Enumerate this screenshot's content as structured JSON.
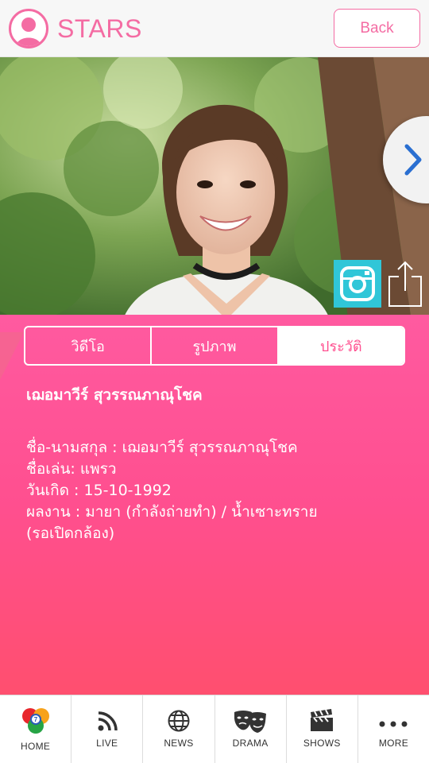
{
  "header": {
    "title": "STARS",
    "back_label": "Back",
    "avatar_icon": "person-silhouette-icon"
  },
  "photo": {
    "next_icon": "chevron-right-icon",
    "instagram_icon": "instagram-icon",
    "share_icon": "share-icon"
  },
  "tabs": [
    {
      "label": "วิดีโอ",
      "active": false
    },
    {
      "label": "รูปภาพ",
      "active": false
    },
    {
      "label": "ประวัติ",
      "active": true
    }
  ],
  "profile": {
    "name": "เฌอมาวีร์ สุวรรณภาณุโชค",
    "bio_lines": [
      "ชื่อ-นามสกุล : เฌอมาวีร์ สุวรรณภาณุโชค",
      "ชื่อเล่น: แพรว",
      "วันเกิด : 15-10-1992",
      "ผลงาน : มายา (กำลังถ่ายทำ) / น้ำเซาะทราย",
      "(รอเปิดกล้อง)"
    ]
  },
  "tabbar": [
    {
      "label": "HOME",
      "icon": "ch7-logo-icon"
    },
    {
      "label": "LIVE",
      "icon": "rss-icon"
    },
    {
      "label": "NEWS",
      "icon": "globe-icon"
    },
    {
      "label": "DRAMA",
      "icon": "theater-masks-icon"
    },
    {
      "label": "SHOWS",
      "icon": "clapperboard-icon"
    },
    {
      "label": "MORE",
      "icon": "more-dots-icon"
    }
  ],
  "colors": {
    "accent": "#f46ca3",
    "panel_top": "#ff5aa0",
    "panel_bottom": "#ff4f6f",
    "instagram": "#30c6d8",
    "chevron": "#2a6fd1"
  }
}
